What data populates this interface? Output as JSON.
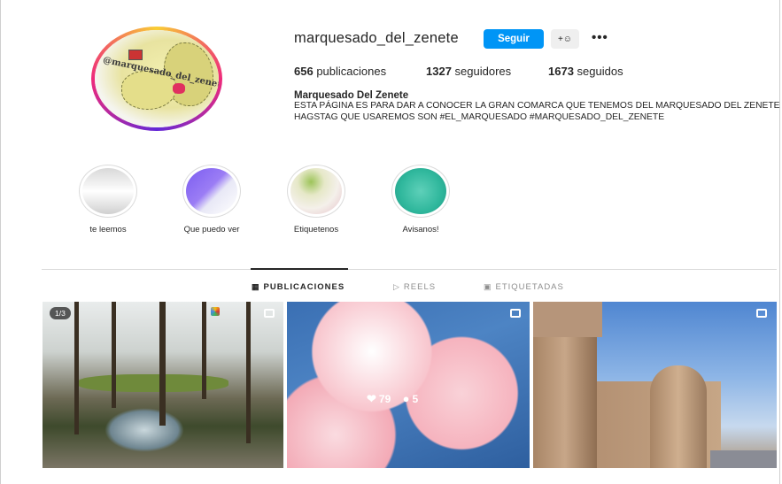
{
  "profile": {
    "username": "marquesado_del_zenete",
    "avatar_text": "@marquesado_del_zenete",
    "follow_label": "Seguir",
    "suggest_label": "+&#9786;",
    "more_label": "•••",
    "stats": {
      "posts_count": "656",
      "posts_label": "publicaciones",
      "followers_count": "1327",
      "followers_label": "seguidores",
      "following_count": "1673",
      "following_label": "seguidos"
    },
    "bio": {
      "name": "Marquesado Del Zenete",
      "line1": "ESTA PÁGINA ES PARA DAR A CONOCER LA GRAN COMARCA QUE TENEMOS DEL MARQUESADO DEL ZENETE",
      "line2": "HAGSTAG QUE USAREMOS SON #EL_MARQUESADO #MARQUESADO_DEL_ZENETE"
    }
  },
  "highlights": [
    {
      "label": "te leemos"
    },
    {
      "label": "Que puedo ver"
    },
    {
      "label": "Etiquetenos"
    },
    {
      "label": "Avisanos!"
    }
  ],
  "tabs": {
    "posts": "PUBLICACIONES",
    "reels": "REELS",
    "tagged": "ETIQUETADAS"
  },
  "posts": {
    "p1_badge": "1/3",
    "p2_likes": "79",
    "p2_comments": "5"
  },
  "colors": {
    "accent": "#0095f6",
    "text": "#262626",
    "border": "#dbdbdb"
  }
}
